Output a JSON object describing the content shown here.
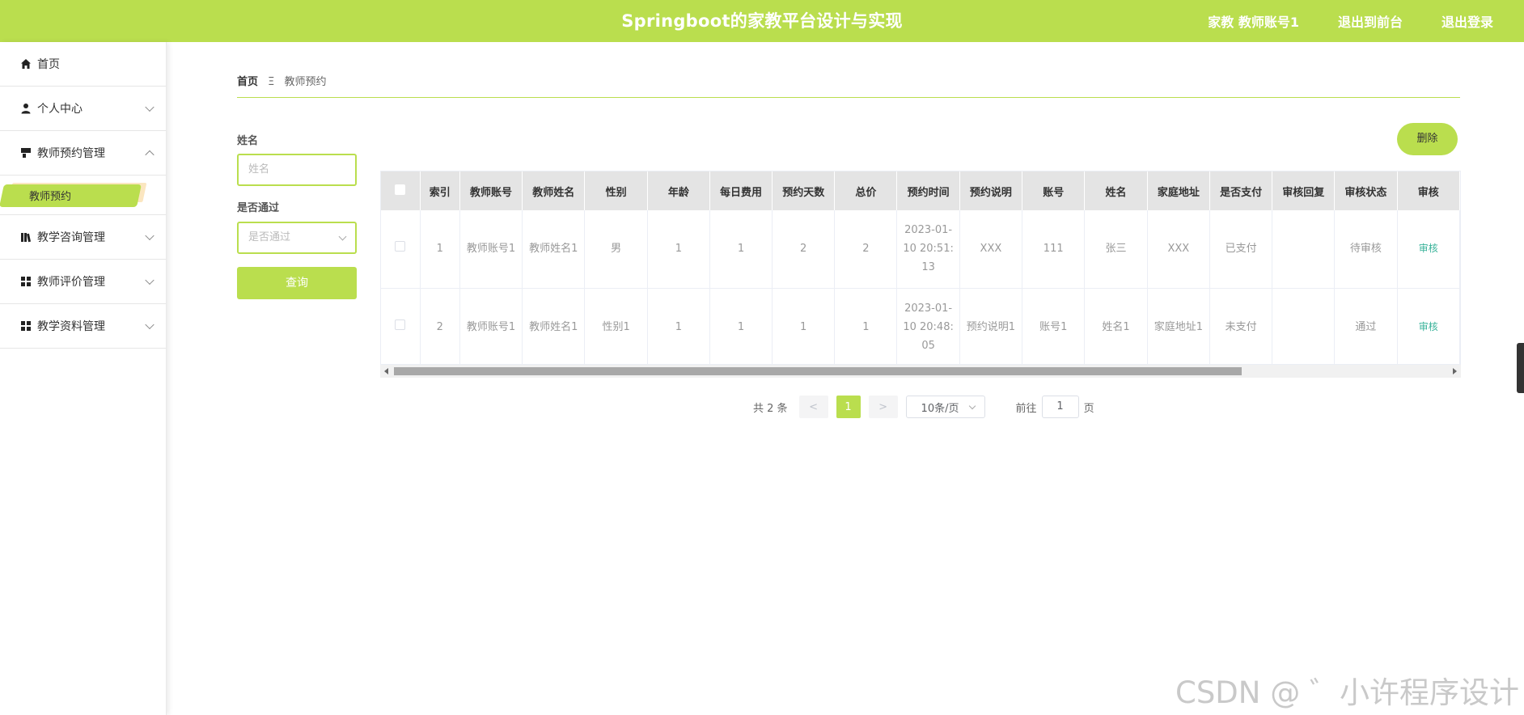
{
  "header": {
    "title": "Springboot的家教平台设计与实现",
    "user": "家教 教师账号1",
    "back_to_front": "退出到前台",
    "logout": "退出登录",
    "accent": "#bade4e"
  },
  "sidebar": {
    "items": [
      {
        "label": "首页",
        "icon": "home-icon"
      },
      {
        "label": "个人中心",
        "icon": "user-icon"
      },
      {
        "label": "教师预约管理",
        "icon": "appointment-icon"
      },
      {
        "label": "教学咨询管理",
        "icon": "book-icon"
      },
      {
        "label": "教师评价管理",
        "icon": "grid-icon"
      },
      {
        "label": "教学资料管理",
        "icon": "grid-icon"
      }
    ],
    "active_sub": "教师预约"
  },
  "breadcrumb": {
    "home": "首页",
    "separator": "Ξ",
    "current": "教师预约"
  },
  "search": {
    "name_label": "姓名",
    "name_placeholder": "姓名",
    "pass_label": "是否通过",
    "pass_placeholder": "是否通过",
    "query_label": "查询"
  },
  "delete_label": "删除",
  "table": {
    "columns": [
      "索引",
      "教师账号",
      "教师姓名",
      "性别",
      "年龄",
      "每日费用",
      "预约天数",
      "总价",
      "预约时间",
      "预约说明",
      "账号",
      "姓名",
      "家庭地址",
      "是否支付",
      "审核回复",
      "审核状态",
      "审核"
    ],
    "rows": [
      [
        "1",
        "教师账号1",
        "教师姓名1",
        "男",
        "1",
        "1",
        "2",
        "2",
        "2023-01-10 20:51:13",
        "XXX",
        "111",
        "张三",
        "XXX",
        "已支付",
        "",
        "待审核",
        "审核"
      ],
      [
        "2",
        "教师账号1",
        "教师姓名1",
        "性别1",
        "1",
        "1",
        "1",
        "1",
        "2023-01-10 20:48:05",
        "预约说明1",
        "账号1",
        "姓名1",
        "家庭地址1",
        "未支付",
        "",
        "通过",
        "审核"
      ]
    ]
  },
  "pagination": {
    "total": "共 2 条",
    "prev": "<",
    "current_page": "1",
    "next": ">",
    "page_size": "10条/页",
    "goto_label": "前往",
    "goto_value": "1",
    "page_suffix": "页"
  },
  "watermark": "CSDN @ ゛小许程序设计"
}
